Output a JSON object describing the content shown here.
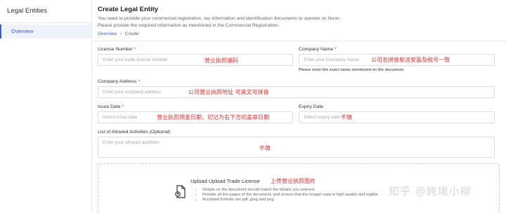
{
  "sidebar": {
    "title": "Legal Entities",
    "items": [
      {
        "label": "Overview"
      }
    ]
  },
  "header": {
    "title": "Create Legal Entity",
    "subtitle_line1": "You need to provide your commercial registration, tax information and identification documents to operate on Noon.",
    "subtitle_line2": "Please provide the required information as mentioned in the Commercial Registration.",
    "breadcrumb": {
      "link": "Overview",
      "separator": "/",
      "current": "Create"
    }
  },
  "form": {
    "license_number": {
      "label": "License Number",
      "required_mark": "*",
      "placeholder": "Enter your trade license number",
      "annotation": "营业执照编码"
    },
    "company_name": {
      "label": "Company Name",
      "required_mark": "*",
      "placeholder": "Enter your Company Name",
      "annotation": "公司名拼音和派安盈及税号一致",
      "helper": "Please enter the exact name mentioned on the document."
    },
    "company_address": {
      "label": "Company Address",
      "required_mark": "*",
      "placeholder": "Enter your company address",
      "annotation": "公司营业执照地址 可英文可拼音"
    },
    "issue_date": {
      "label": "Issue Date",
      "required_mark": "*",
      "placeholder": "Select issue date",
      "annotation": "营业执照颁发日期，切记为右下方的盖章日期"
    },
    "expiry_date": {
      "label": "Expiry Date",
      "placeholder": "Select expiry date",
      "annotation": "不填"
    },
    "activities": {
      "label": "List of Allowed Activities (Optional)",
      "placeholder": "Enter your allowed activities",
      "annotation": "不填"
    }
  },
  "upload": {
    "title": "Upload Upload Trade License",
    "annotation": "上传营业执照图片",
    "notes": [
      "Details on the document should match the details you entered.",
      "Provide all the pages of the document, and ensure that the image/ copy is high quality and legible.",
      "Accepted formats are pdf, jpeg and png."
    ],
    "icon": "document-upload-icon"
  },
  "watermark": "知乎 @跨境小柳",
  "colors": {
    "accent": "#3b5bdb",
    "annotation": "#e03131",
    "border": "#d9dce1"
  }
}
